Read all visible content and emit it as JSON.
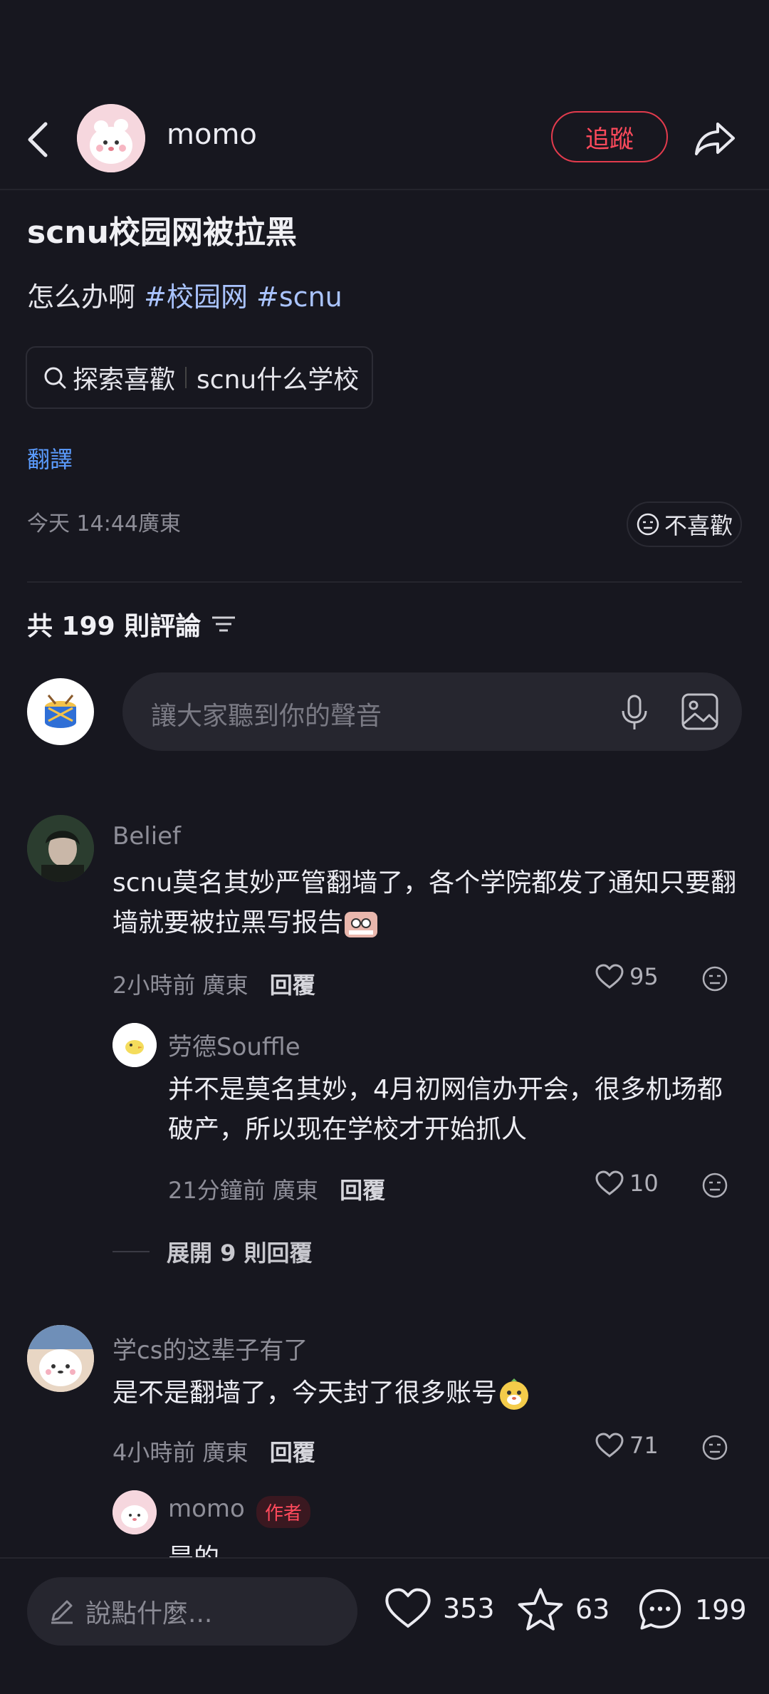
{
  "header": {
    "username": "momo",
    "follow_label": "追蹤"
  },
  "post": {
    "title": "scnu校园网被拉黑",
    "body_text": "怎么办啊",
    "tags": [
      "#校园网",
      "#scnu"
    ],
    "search_chip": {
      "left": "探索喜歡",
      "right": "scnu什么学校"
    },
    "translate_label": "翻譯",
    "timestamp": "今天 14:44廣東",
    "dislike_label": "不喜歡"
  },
  "comments_header": {
    "title": "共 199 則評論"
  },
  "comment_input": {
    "placeholder": "讓大家聽到你的聲音"
  },
  "comments": [
    {
      "name": "Belief",
      "text_line1": "scnu莫名其妙严管翻墙了，各个学院都发了通知只要翻",
      "text_line2": "墙就要被拉黑写报告",
      "time": "2小時前",
      "region": "廣東",
      "reply_label": "回覆",
      "likes": "95"
    },
    {
      "name": "劳德Souffle",
      "text_line1": "并不是莫名其妙，4月初网信办开会，很多机场都",
      "text_line2": "破产，所以现在学校才开始抓人",
      "time": "21分鐘前",
      "region": "廣東",
      "reply_label": "回覆",
      "likes": "10"
    },
    {
      "name": "学cs的这辈子有了",
      "text_line1": "是不是翻墙了，今天封了很多账号",
      "time": "4小時前",
      "region": "廣東",
      "reply_label": "回覆",
      "likes": "71"
    },
    {
      "name": "momo",
      "badge": "作者",
      "text_line1": "是的"
    }
  ],
  "expand_replies": "展開 9 則回覆",
  "bottom_bar": {
    "placeholder": "說點什麼...",
    "likes": "353",
    "favorites": "63",
    "comments": "199"
  },
  "colors": {
    "background": "#17171f",
    "accent": "#ff4a5c",
    "link": "#5b9cff",
    "tag": "#aac4ff"
  }
}
